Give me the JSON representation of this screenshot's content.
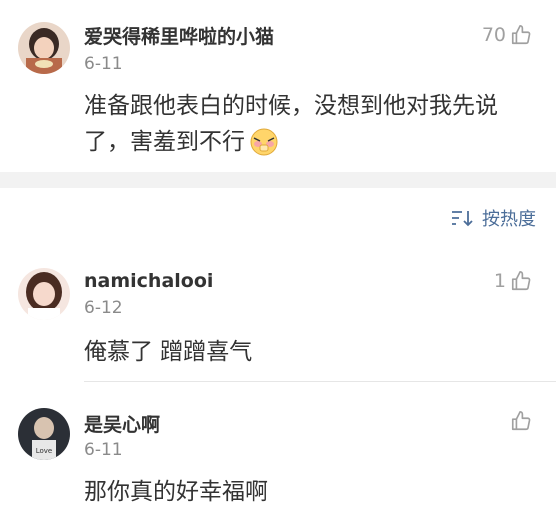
{
  "comments": [
    {
      "username": "爱哭得稀里哗啦的小猫",
      "date": "6-11",
      "likes": "70",
      "text_line1": "准备跟他表白的时候，没想到他对我先说",
      "text_line2": "了，害羞到不行"
    },
    {
      "username": "namichalooi",
      "date": "6-12",
      "likes": "1",
      "text": "俺慕了 蹭蹭喜气"
    },
    {
      "username": "是吴心啊",
      "date": "6-11",
      "likes": "",
      "text": "那你真的好幸福啊"
    }
  ],
  "sort": {
    "label": "按热度"
  },
  "colors": {
    "link": "#4c6e99",
    "muted": "#8a8a8a",
    "separator": "#f2f2f2"
  },
  "icons": [
    "thumbs-up-icon",
    "sort-icon",
    "shy-face-emoji"
  ]
}
